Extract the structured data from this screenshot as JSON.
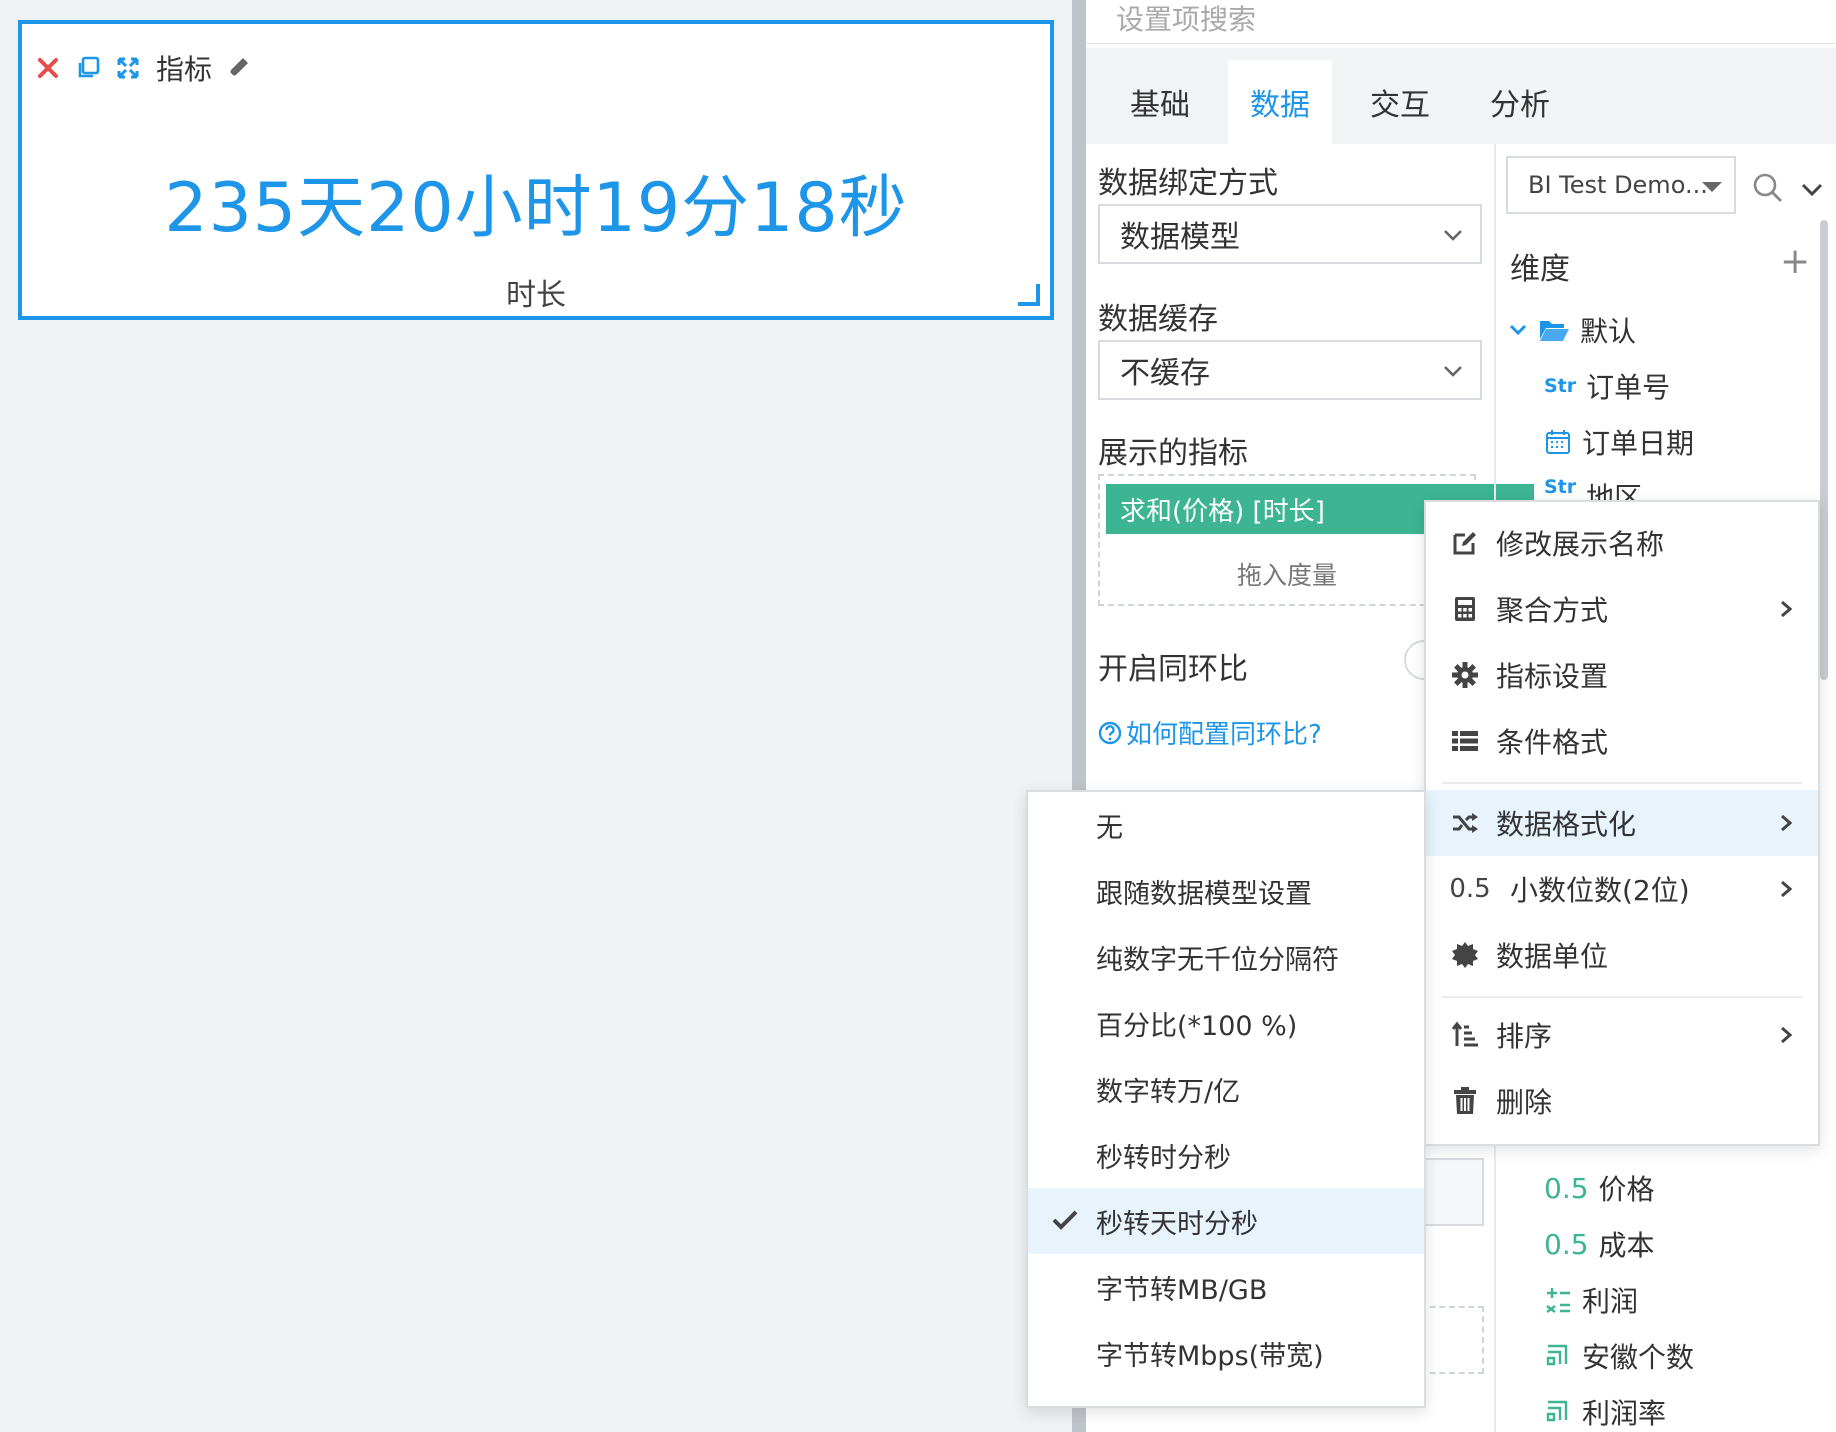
{
  "search": {
    "placeholder": "设置项搜索"
  },
  "tabs": [
    "基础",
    "数据",
    "交互",
    "分析"
  ],
  "widget": {
    "title": "指标",
    "value": "235天20小时19分18秒",
    "label": "时长"
  },
  "data_settings": {
    "binding_label": "数据绑定方式",
    "binding_value": "数据模型",
    "cache_label": "数据缓存",
    "cache_value": "不缓存",
    "metric_label": "展示的指标",
    "measure_chip": "求和(价格) [时长]",
    "drop_hint": "拖入度量",
    "yoy_label": "开启同环比",
    "help_link": "如何配置同环比?"
  },
  "fields": {
    "source": "BI Test Demo...",
    "dimension_title": "维度",
    "folder": "默认",
    "dimensions": [
      {
        "tag": "Str",
        "name": "订单号"
      },
      {
        "tag": "date",
        "name": "订单日期"
      },
      {
        "tag": "Str",
        "name": "地区"
      }
    ],
    "measures": [
      {
        "tag": "0.5",
        "name": "价格"
      },
      {
        "tag": "0.5",
        "name": "成本"
      },
      {
        "tag": "calc",
        "name": "利润"
      },
      {
        "tag": "calc2",
        "name": "安徽个数"
      },
      {
        "tag": "calc2",
        "name": "利润率"
      }
    ]
  },
  "context_menu": {
    "items": [
      {
        "label": "修改展示名称",
        "icon": "edit-icon"
      },
      {
        "label": "聚合方式",
        "icon": "calculator-icon",
        "submenu": true
      },
      {
        "label": "指标设置",
        "icon": "gear-icon"
      },
      {
        "label": "条件格式",
        "icon": "list-icon"
      },
      {
        "label": "数据格式化",
        "icon": "shuffle-icon",
        "submenu": true
      },
      {
        "label": "小数位数(2位)",
        "icon": "decimal-icon",
        "icon_text": "0.5",
        "submenu": true
      },
      {
        "label": "数据单位",
        "icon": "badge-icon"
      },
      {
        "label": "排序",
        "icon": "sort-icon",
        "submenu": true
      },
      {
        "label": "删除",
        "icon": "trash-icon"
      }
    ]
  },
  "format_submenu": {
    "options": [
      "无",
      "跟随数据模型设置",
      "纯数字无千位分隔符",
      "百分比(*100 %)",
      "数字转万/亿",
      "秒转时分秒",
      "秒转天时分秒",
      "字节转MB/GB",
      "字节转Mbps(带宽)"
    ],
    "selected": "秒转天时分秒"
  },
  "colors": {
    "accent": "#1d95e8",
    "chip": "#3db592",
    "close": "#e84c4c"
  }
}
